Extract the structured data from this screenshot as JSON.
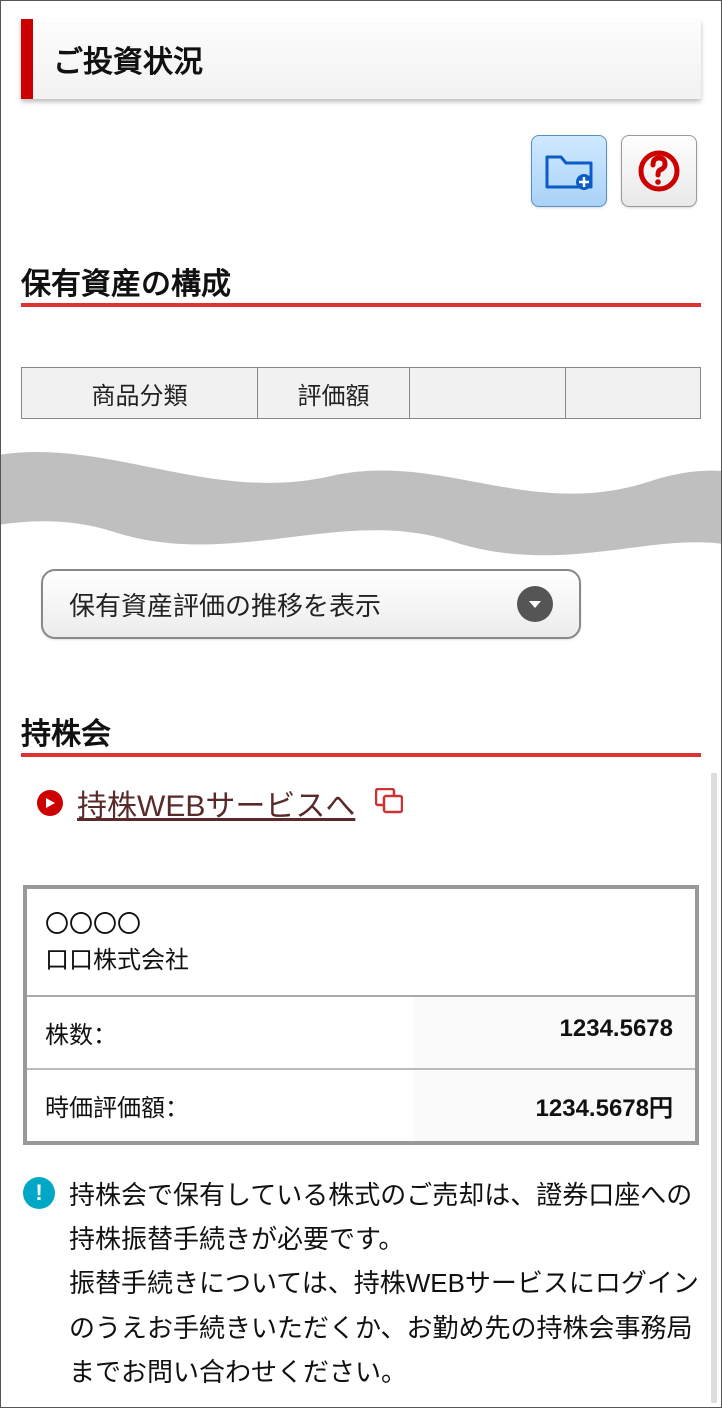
{
  "banner": {
    "title": "ご投資状況"
  },
  "sections": {
    "composition_title": "保有資産の構成",
    "mochikabu_title": "持株会"
  },
  "table_headers": {
    "col1": "商品分類",
    "col2": "評価額",
    "col3": "",
    "col4": ""
  },
  "dropdown": {
    "label": "保有資産評価の推移を表示"
  },
  "link": {
    "label": "持株WEBサービスへ"
  },
  "company": {
    "line1": "〇〇〇〇",
    "line2": "口口株式会社"
  },
  "rows": {
    "shares_label": "株数：",
    "shares_value": "1234.5678",
    "value_label": "時価評価額：",
    "value_value": "1234.5678円"
  },
  "info_text": "持株会で保有している株式のご売却は、證券口座への持株振替手続きが必要です。\n振替手続きについては、持株WEBサービスにログインのうえお手続きいただくか、お勤め先の持株会事務局までお問い合わせください。"
}
